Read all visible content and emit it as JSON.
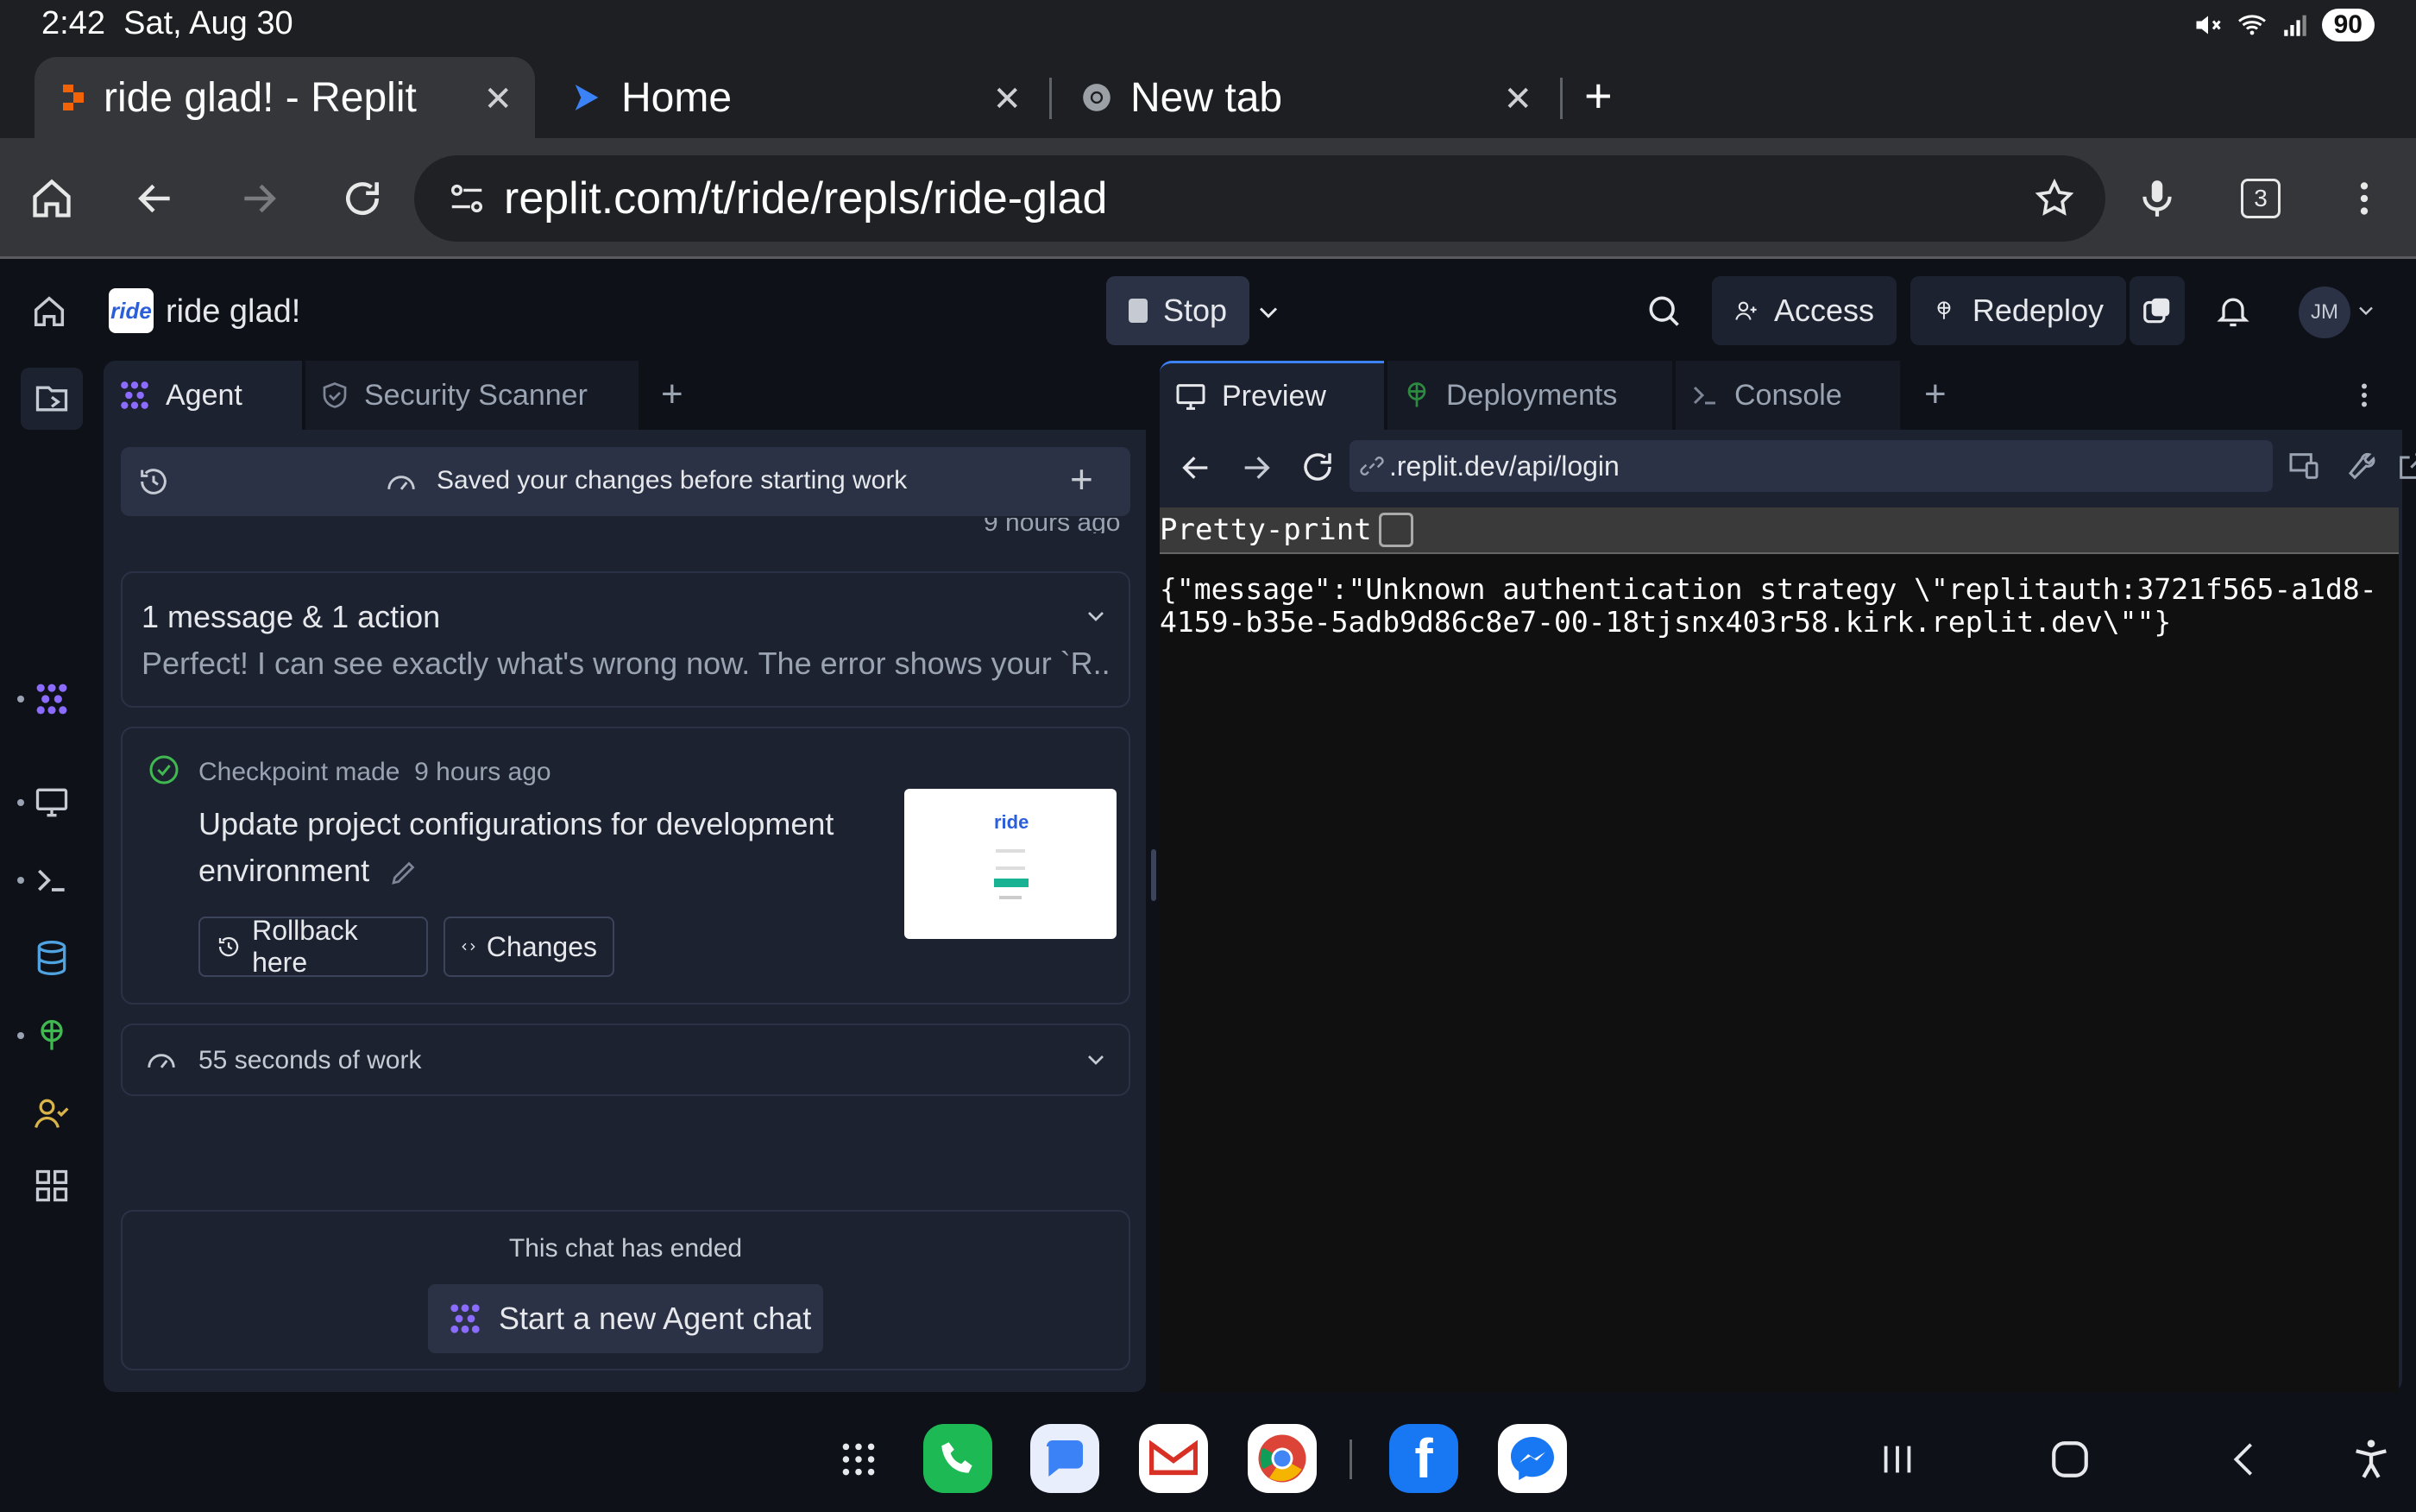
{
  "status_bar": {
    "time": "2:42",
    "date": "Sat, Aug 30",
    "battery": "90"
  },
  "browser": {
    "tabs": [
      {
        "title": "ride glad! - Replit",
        "active": true
      },
      {
        "title": "Home",
        "active": false
      },
      {
        "title": "New tab",
        "active": false
      }
    ],
    "url": "replit.com/t/ride/repls/ride-glad",
    "tab_count": "3"
  },
  "app": {
    "project_name": "ride glad!",
    "stop_label": "Stop",
    "access_label": "Access",
    "redeploy_label": "Redeploy",
    "avatar_initials": "JM"
  },
  "left_panel": {
    "tabs": [
      "Agent",
      "Security Scanner"
    ],
    "history_bar": {
      "text": "Saved your changes before starting work",
      "time_fragment": "9 hours ago"
    },
    "message_group": {
      "title": "1 message & 1 action",
      "preview": "Perfect! I can see exactly what's wrong now. The error shows your `R..."
    },
    "checkpoint": {
      "status": "Checkpoint made",
      "time": "9 hours ago",
      "title": "Update project configurations for development environment",
      "rollback_label": "Rollback here",
      "changes_label": "Changes",
      "thumbnail_logo": "ride"
    },
    "work_summary": "55 seconds of work",
    "chat_ended": {
      "text": "This chat has ended",
      "button": "Start a new Agent chat"
    }
  },
  "right_panel": {
    "tabs": [
      "Preview",
      "Deployments",
      "Console"
    ],
    "preview_url": ".replit.dev/api/login",
    "pretty_print_label": "Pretty-print",
    "response_line1": "{\"message\":\"Unknown authentication strategy \\\"replitauth:3721f565-a1d8-",
    "response_line2": "4159-b35e-5adb9d86c8e7-00-18tjsnx403r58.kirk.replit.dev\\\"\"}"
  },
  "colors": {
    "accent_purple": "#8b6cff",
    "success_green": "#3fb950",
    "background": "#0e1117",
    "panel": "#1c2230"
  }
}
